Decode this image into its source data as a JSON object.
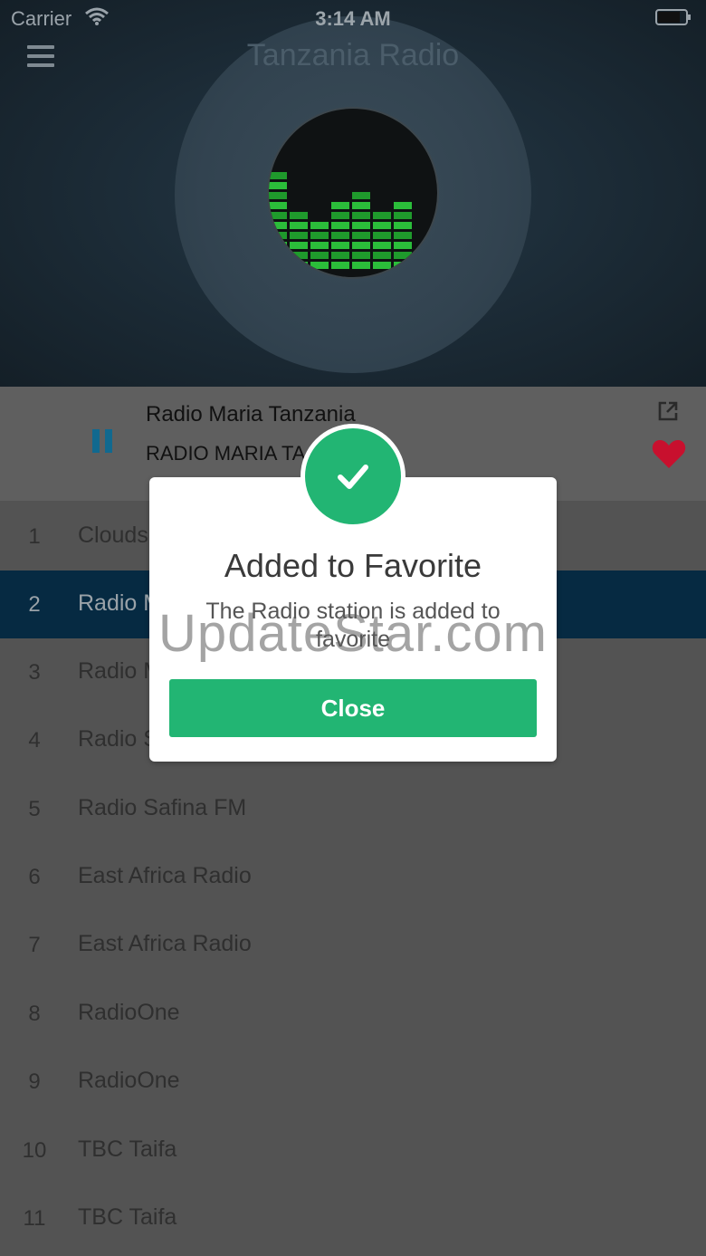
{
  "status_bar": {
    "carrier": "Carrier",
    "time": "3:14 AM"
  },
  "header": {
    "title": "Tanzania Radio"
  },
  "now_playing": {
    "title": "Radio Maria Tanzania",
    "subtitle": "RADIO MARIA TA"
  },
  "stations": [
    {
      "num": "1",
      "name": "Clouds"
    },
    {
      "num": "2",
      "name": "Radio M"
    },
    {
      "num": "3",
      "name": "Radio M"
    },
    {
      "num": "4",
      "name": "Radio S"
    },
    {
      "num": "5",
      "name": "Radio Safina FM"
    },
    {
      "num": "6",
      "name": "East Africa Radio"
    },
    {
      "num": "7",
      "name": "East Africa Radio"
    },
    {
      "num": "8",
      "name": "RadioOne"
    },
    {
      "num": "9",
      "name": "RadioOne"
    },
    {
      "num": "10",
      "name": "TBC Taifa"
    },
    {
      "num": "11",
      "name": "TBC Taifa"
    }
  ],
  "modal": {
    "title": "Added to Favorite",
    "message": "The Radio station is added to favorite",
    "close_label": "Close"
  },
  "watermark": "UpdateStar.com",
  "colors": {
    "accent_green": "#22b573",
    "active_row": "#062a42",
    "pause_blue": "#11698f",
    "heart_red": "#c8102e"
  },
  "icons": [
    "menu-icon",
    "wifi-icon",
    "battery-icon",
    "pause-icon",
    "share-icon",
    "heart-icon",
    "check-icon"
  ]
}
